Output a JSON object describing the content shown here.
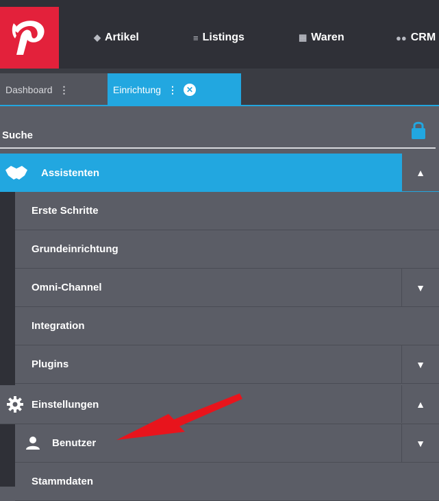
{
  "topbar": {
    "nav": [
      {
        "label": "Artikel",
        "icon": "tag-icon"
      },
      {
        "label": "Listings",
        "icon": "list-icon"
      },
      {
        "label": "Waren",
        "icon": "boxes-icon"
      },
      {
        "label": "CRM",
        "icon": "users-icon"
      }
    ]
  },
  "tabs": [
    {
      "label": "Dashboard",
      "dots": "⋮"
    },
    {
      "label": "Einrichtung",
      "dots": "⋮",
      "close": "✕"
    }
  ],
  "search": {
    "label": "Suche"
  },
  "menu": {
    "assistenten": {
      "label": "Assistenten",
      "items": [
        {
          "label": "Erste Schritte"
        },
        {
          "label": "Grundeinrichtung"
        },
        {
          "label": "Omni-Channel"
        },
        {
          "label": "Integration"
        },
        {
          "label": "Plugins"
        }
      ]
    },
    "einstellungen": {
      "label": "Einstellungen",
      "items": [
        {
          "label": "Benutzer"
        },
        {
          "label": "Stammdaten"
        }
      ]
    }
  },
  "colors": {
    "accent": "#22a7e0",
    "brand": "#e3213b",
    "annotation": "#e8141c"
  }
}
